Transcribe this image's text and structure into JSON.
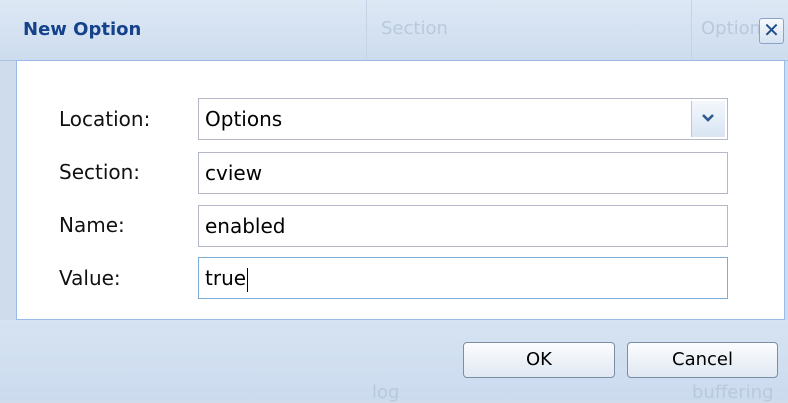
{
  "dialog": {
    "title": "New Option",
    "close_glyph": "✕"
  },
  "background": {
    "column_section": "Section",
    "column_option": "Option",
    "row_log": "log",
    "row_buffering": "buffering"
  },
  "form": {
    "location_label": "Location:",
    "location_value": "Options",
    "section_label": "Section:",
    "section_value": "cview",
    "name_label": "Name:",
    "name_value": "enabled",
    "value_label": "Value:",
    "value_value": "true"
  },
  "buttons": {
    "ok": "OK",
    "cancel": "Cancel"
  },
  "colors": {
    "title": "#15428b",
    "panel_border": "#99bbe8",
    "window_bg": "#cfdcec"
  },
  "icons": {
    "close": "close-icon",
    "dropdown": "chevron-down-icon"
  }
}
